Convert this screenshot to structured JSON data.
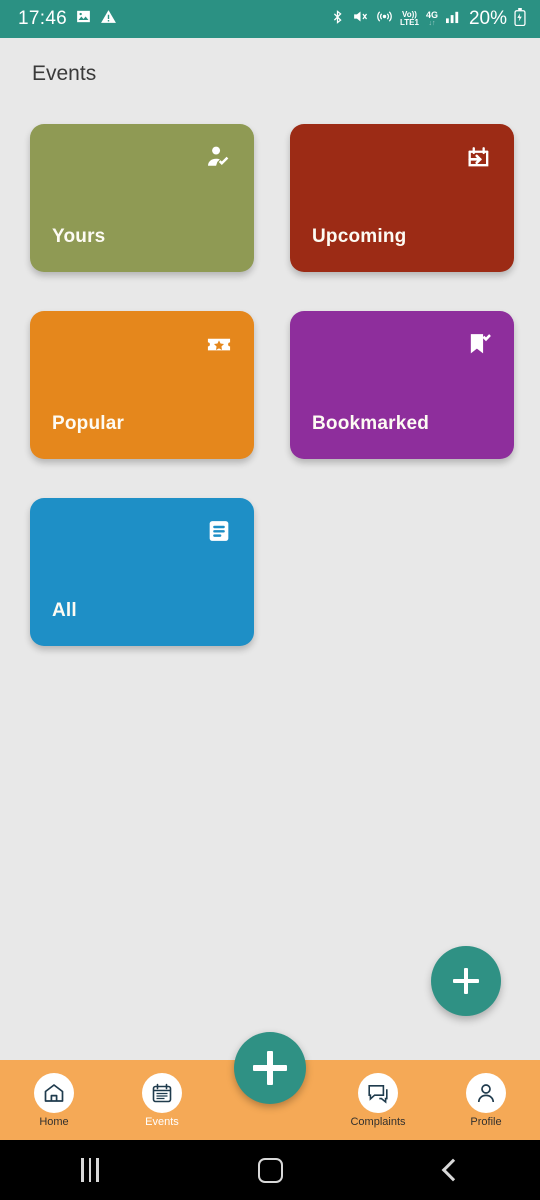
{
  "status_bar": {
    "time": "17:46",
    "battery_percent": "20%",
    "volte_top": "Vo))",
    "volte_bottom": "LTE1",
    "network_main": "4G",
    "network_sub": "↓↑",
    "icons": [
      "image-icon",
      "warning-icon",
      "bluetooth-icon",
      "mute-icon",
      "hotspot-icon",
      "volte-icon",
      "network-4g-icon",
      "signal-bars-icon",
      "battery-icon"
    ],
    "background_color": "#2b9183"
  },
  "screen": {
    "title": "Events",
    "background_color": "#e8e8e8"
  },
  "cards": [
    {
      "label": "Yours",
      "color": "#8f9a54",
      "icon": "person-check-icon"
    },
    {
      "label": "Upcoming",
      "color": "#9c2b15",
      "icon": "calendar-arrow-icon"
    },
    {
      "label": "Popular",
      "color": "#e5871c",
      "icon": "ticket-star-icon"
    },
    {
      "label": "Bookmarked",
      "color": "#8e2e9c",
      "icon": "bookmark-check-icon"
    },
    {
      "label": "All",
      "color": "#1e8fc6",
      "icon": "document-lines-icon"
    }
  ],
  "fab_side": {
    "icon": "plus-icon",
    "color": "#2f9184"
  },
  "fab_center": {
    "icon": "plus-icon",
    "color": "#2f9184"
  },
  "bottom_nav": {
    "background_color": "#f5a956",
    "items": [
      {
        "label": "Home",
        "icon": "home-icon",
        "active": false
      },
      {
        "label": "Events",
        "icon": "calendar-icon",
        "active": true
      },
      {
        "label": "Complaints",
        "icon": "chat-bubble-icon",
        "active": false
      },
      {
        "label": "Profile",
        "icon": "person-icon",
        "active": false
      }
    ]
  },
  "android_nav": {
    "recents": "recents-icon",
    "home": "home-square-icon",
    "back": "back-chevron-icon"
  }
}
